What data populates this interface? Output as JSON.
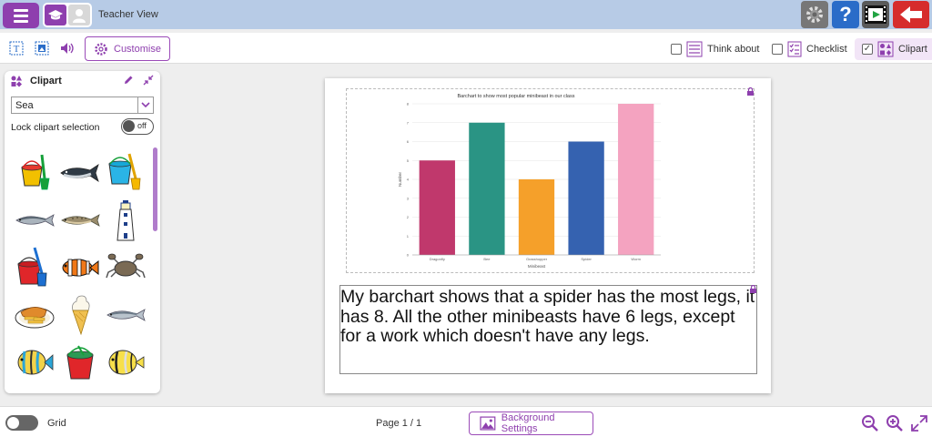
{
  "topbar": {
    "view_label": "Teacher View"
  },
  "toolbar": {
    "customise_label": "Customise",
    "think_about_label": "Think about",
    "checklist_label": "Checklist",
    "clipart_label": "Clipart",
    "clipart_checked": "✓"
  },
  "panel": {
    "title": "Clipart",
    "category": "Sea",
    "lock_label": "Lock clipart selection",
    "lock_state": "off",
    "items": [
      "bucket-spade",
      "tuna-fish",
      "bucket-spade-blue",
      "herring",
      "trout",
      "lighthouse",
      "bucket-spade-red",
      "clownfish",
      "crab",
      "fish-and-chips",
      "ice-cream",
      "sardine",
      "angelfish",
      "bucket-red",
      "butterflyfish"
    ]
  },
  "page": {
    "text": "My barchart shows that a spider has the most legs, it has 8. All the other minibeasts have 6 legs, except for a work which doesn't have any legs."
  },
  "chart_data": {
    "type": "bar",
    "title": "Barchart to show most popular minibeast in our class",
    "xlabel": "Minibeast",
    "ylabel": "Number",
    "categories": [
      "Dragonfly",
      "Bee",
      "Grasshopper",
      "Spider",
      "Worm"
    ],
    "values": [
      5,
      7,
      4,
      6,
      8
    ],
    "colors": [
      "#c0386c",
      "#2a9484",
      "#f5a02a",
      "#3562b0",
      "#f4a3c0"
    ],
    "yticks": [
      "0",
      "1",
      "2",
      "3",
      "4",
      "5",
      "6",
      "7",
      "8"
    ],
    "ylim": [
      0,
      8
    ]
  },
  "bottombar": {
    "grid_label": "Grid",
    "page_label": "Page 1 / 1",
    "background_settings_label": "Background Settings"
  },
  "colors": {
    "accent": "#8e3fae",
    "topbar": "#b7cbe6"
  }
}
